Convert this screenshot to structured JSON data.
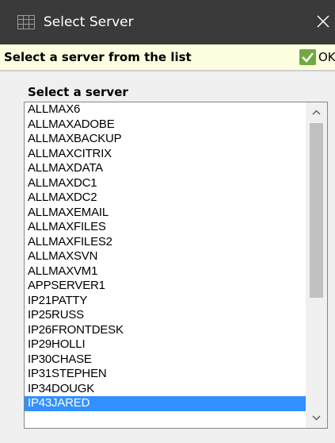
{
  "window": {
    "title": "Select Server"
  },
  "instruction": {
    "text": "Select a server from the list",
    "ok_label": "OK"
  },
  "list": {
    "label": "Select a server",
    "items": [
      "ALLMAX6",
      "ALLMAXADOBE",
      "ALLMAXBACKUP",
      "ALLMAXCITRIX",
      "ALLMAXDATA",
      "ALLMAXDC1",
      "ALLMAXDC2",
      "ALLMAXEMAIL",
      "ALLMAXFILES",
      "ALLMAXFILES2",
      "ALLMAXSVN",
      "ALLMAXVM1",
      "APPSERVER1",
      "IP21PATTY",
      "IP25RUSS",
      "IP26FRONTDESK",
      "IP29HOLLI",
      "IP30CHASE",
      "IP31STEPHEN",
      "IP34DOUGK",
      "IP43JARED"
    ],
    "selected": "IP43JARED"
  },
  "icons": {
    "title_icon": "grid-table-icon",
    "close": "close-icon",
    "ok": "checkmark-icon",
    "scroll_up": "chevron-up-icon",
    "scroll_down": "chevron-down-icon"
  },
  "colors": {
    "titlebar": "#3a3a3a",
    "instruction_bg": "#fefee0",
    "ok_check": "#73a843",
    "selection": "#3390ff"
  }
}
